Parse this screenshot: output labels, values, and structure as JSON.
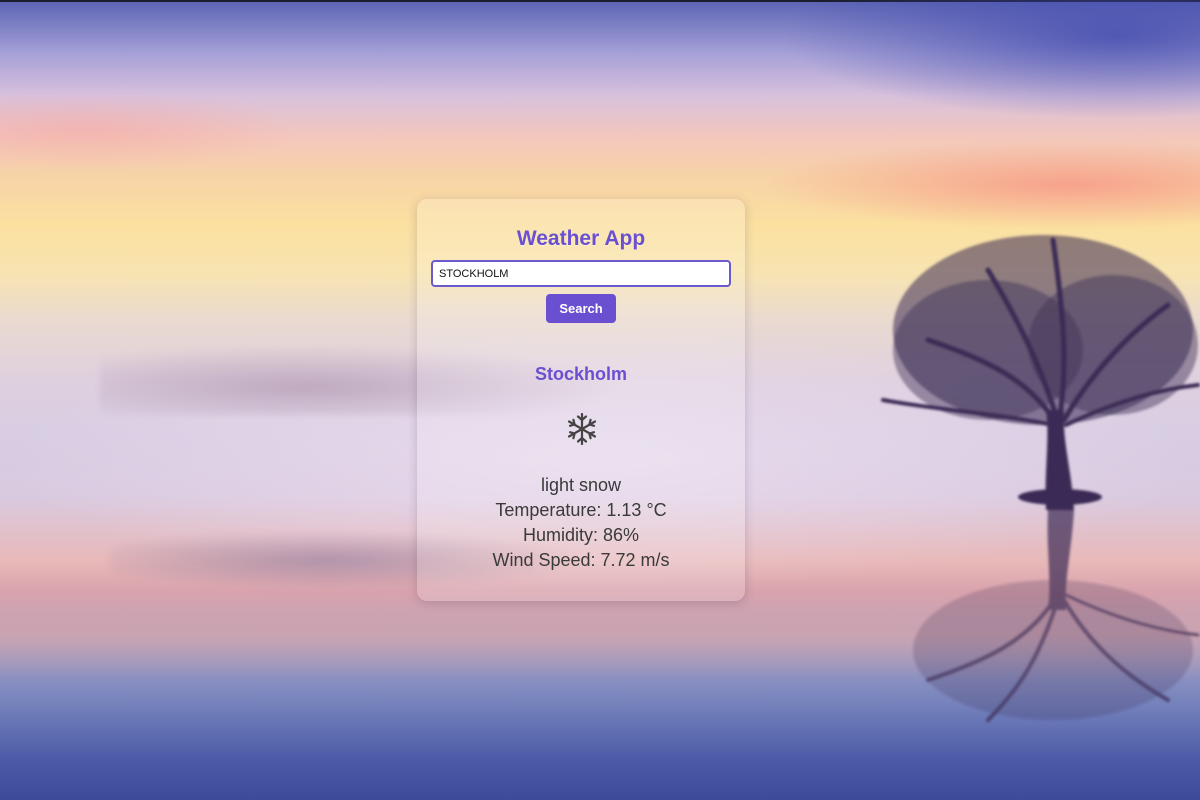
{
  "app": {
    "title": "Weather App"
  },
  "search": {
    "value": "STOCKHOLM",
    "placeholder": "",
    "button_label": "Search"
  },
  "weather": {
    "city": "Stockholm",
    "icon": "snowflake-icon",
    "description": "light snow",
    "temperature": "Temperature: 1.13 °C",
    "humidity": "Humidity: 86%",
    "wind_speed": "Wind Speed: 7.72 m/s"
  },
  "colors": {
    "accent": "#6a4fd1",
    "input_border": "#6a5acd",
    "text": "#3a3a3a"
  }
}
